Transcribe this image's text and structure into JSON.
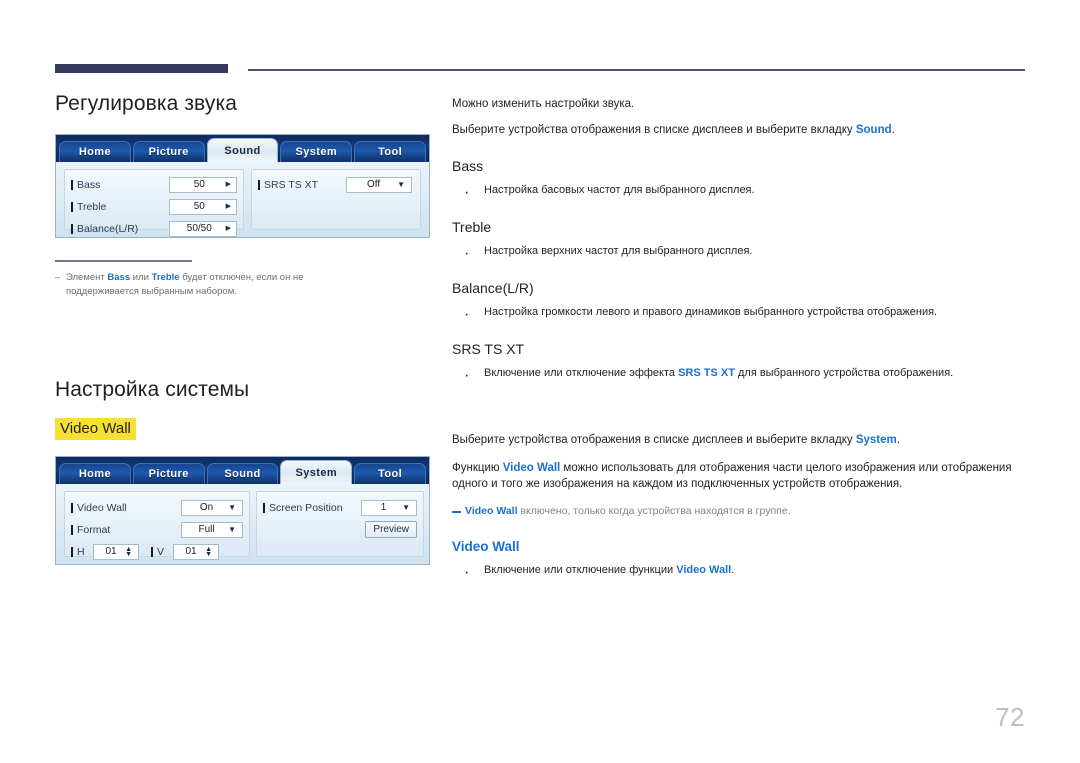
{
  "page": {
    "number": "72"
  },
  "sound_section": {
    "title": "Регулировка звука",
    "mockup": {
      "tabs": [
        {
          "label": "Home",
          "active": false
        },
        {
          "label": "Picture",
          "active": false
        },
        {
          "label": "Sound",
          "active": true
        },
        {
          "label": "System",
          "active": false
        },
        {
          "label": "Tool",
          "active": false
        }
      ],
      "fields_left": [
        {
          "label": "Bass",
          "value": "50",
          "control": "stepper-arrow"
        },
        {
          "label": "Treble",
          "value": "50",
          "control": "stepper-arrow"
        },
        {
          "label": "Balance(L/R)",
          "value": "50/50",
          "control": "stepper-arrow"
        }
      ],
      "fields_right": [
        {
          "label": "SRS TS XT",
          "value": "Off",
          "control": "dropdown"
        }
      ]
    },
    "note": {
      "dash": "–",
      "text_before": "Элемент ",
      "bold1": "Bass",
      "text_mid": " или ",
      "bold2": "Treble",
      "text_after": " будет отключен, если он не поддерживается выбранным набором."
    }
  },
  "system_section": {
    "title": "Настройка системы",
    "highlight_label": "Video Wall",
    "mockup": {
      "tabs": [
        {
          "label": "Home",
          "active": false
        },
        {
          "label": "Picture",
          "active": false
        },
        {
          "label": "Sound",
          "active": false
        },
        {
          "label": "System",
          "active": true
        },
        {
          "label": "Tool",
          "active": false
        }
      ],
      "fields_left": [
        {
          "label": "Video Wall",
          "value": "On",
          "control": "dropdown"
        },
        {
          "label": "Format",
          "value": "Full",
          "control": "dropdown"
        }
      ],
      "fields_hv": [
        {
          "label": "H",
          "value": "01",
          "control": "spinner"
        },
        {
          "label": "V",
          "value": "01",
          "control": "spinner"
        }
      ],
      "fields_right": [
        {
          "label": "Screen Position",
          "value": "1",
          "control": "dropdown"
        }
      ],
      "preview_button": "Preview"
    }
  },
  "right_sound": {
    "intro1": "Можно изменить настройки звука.",
    "intro2_before": "Выберите устройства отображения в списке дисплеев и выберите вкладку ",
    "intro2_link": "Sound",
    "intro2_after": ".",
    "items": [
      {
        "heading": "Bass",
        "bullet": "Настройка басовых частот для выбранного дисплея."
      },
      {
        "heading": "Treble",
        "bullet": "Настройка верхних частот для выбранного дисплея."
      },
      {
        "heading": "Balance(L/R)",
        "bullet": "Настройка громкости левого и правого динамиков выбранного устройства отображения."
      },
      {
        "heading": "SRS TS XT",
        "bullet_before": "Включение или отключение эффекта ",
        "bullet_link": "SRS TS XT",
        "bullet_after": " для выбранного устройства отображения."
      }
    ]
  },
  "right_system": {
    "intro1_before": "Выберите устройства отображения в списке дисплеев и выберите вкладку ",
    "intro1_link": "System",
    "intro1_after": ".",
    "intro2_before": "Функцию ",
    "intro2_link": "Video Wall",
    "intro2_after": " можно использовать для отображения части целого изображения или отображения одного и того же изображения на каждом из подключенных устройств отображения.",
    "note_link": "Video Wall",
    "note_after": " включено, только когда устройства находятся в группе.",
    "heading": "Video Wall",
    "bullet_before": "Включение или отключение функции ",
    "bullet_link": "Video Wall",
    "bullet_after": "."
  },
  "colors": {
    "accent_blue": "#1b6fd4",
    "rule_navy": "#333a5c",
    "highlight_yellow": "#f5e033",
    "page_number_grey": "#bcbec0"
  }
}
